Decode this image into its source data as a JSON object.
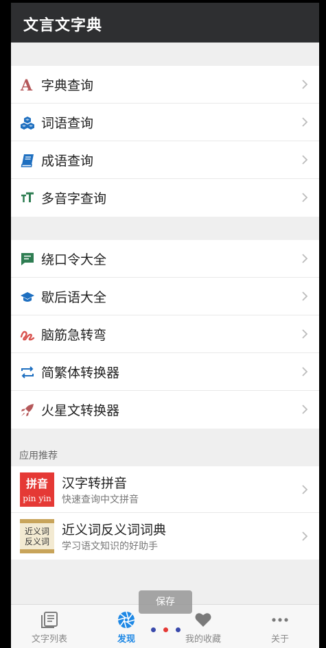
{
  "app": {
    "title": "文言文字典"
  },
  "menu_group_1": [
    {
      "label": "字典查询",
      "icon": "font-a-icon",
      "color": "#b5585a"
    },
    {
      "label": "词语查询",
      "icon": "cubes-icon",
      "color": "#1e6fc0"
    },
    {
      "label": "成语查询",
      "icon": "book-icon",
      "color": "#1e6fc0"
    },
    {
      "label": "多音字查询",
      "icon": "text-height-icon",
      "color": "#2e7d52"
    }
  ],
  "menu_group_2": [
    {
      "label": "绕口令大全",
      "icon": "comment-icon",
      "color": "#2e7d52"
    },
    {
      "label": "歇后语大全",
      "icon": "graduation-cap-icon",
      "color": "#1e6fc0"
    },
    {
      "label": "脑筋急转弯",
      "icon": "squiggle-icon",
      "color": "#d9534f"
    },
    {
      "label": "简繁体转换器",
      "icon": "swap-icon",
      "color": "#1e6fc0"
    },
    {
      "label": "火星文转换器",
      "icon": "rocket-icon",
      "color": "#b5585a"
    }
  ],
  "recommend": {
    "title": "应用推荐",
    "apps": [
      {
        "name": "汉字转拼音",
        "desc": "快速查询中文拼音",
        "icon_text_top": "拼音",
        "icon_text_bottom": "pin yin"
      },
      {
        "name": "近义词反义词词典",
        "desc": "学习语文知识的好助手",
        "icon_text_top": "近义词",
        "icon_text_bottom": "反义词"
      }
    ]
  },
  "toast": {
    "text": "保存"
  },
  "tabs": [
    {
      "label": "文字列表",
      "icon": "list-icon"
    },
    {
      "label": "发现",
      "icon": "aperture-icon"
    },
    {
      "label": "我的收藏",
      "icon": "heart-icon"
    },
    {
      "label": "关于",
      "icon": "more-icon"
    }
  ],
  "colors": {
    "accent": "#1e88e5",
    "appbar": "#2e2f31",
    "background": "#efefef"
  }
}
